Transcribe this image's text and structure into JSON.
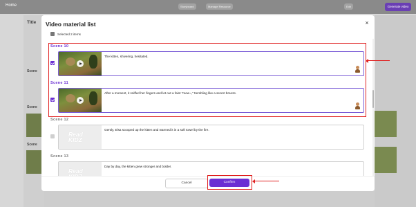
{
  "background": {
    "home_label": "Home",
    "topbar_pills": [
      "Storyboard",
      "Manage Resource"
    ],
    "top_right": [
      "Edit",
      "Generate video"
    ],
    "left_labels": [
      "Title",
      "Scene",
      "Scene",
      "Scene"
    ]
  },
  "modal": {
    "title": "Video material list",
    "selected_label": "Selected 2 items",
    "close_label": "×",
    "cancel_label": "Cancel",
    "confirm_label": "Confirm"
  },
  "scenes": [
    {
      "label": "Scene 10",
      "text": "The kitten, shivering, hesitated.",
      "selected": true,
      "media": "video-thumbnail"
    },
    {
      "label": "Scene 11",
      "text": "After a moment, it sniffed her fingers and let out a faint \"mew~,\" trembling like a secret breeze.",
      "selected": true,
      "media": "video-thumbnail"
    },
    {
      "label": "Scene 12",
      "text": "Gently, Elsa scooped up the kitten and warmed it in a soft towel by the fire.",
      "selected": false,
      "media": "ReadKidz placeholder"
    },
    {
      "label": "Scene 13",
      "text": "Day by day, the kitten grew stronger and bolder.",
      "selected": false,
      "media": "ReadKidz placeholder"
    }
  ],
  "placeholder_logo": [
    "Read",
    "KIDZ"
  ],
  "colors": {
    "accent": "#6b2fd3",
    "annotation": "#e02020"
  }
}
